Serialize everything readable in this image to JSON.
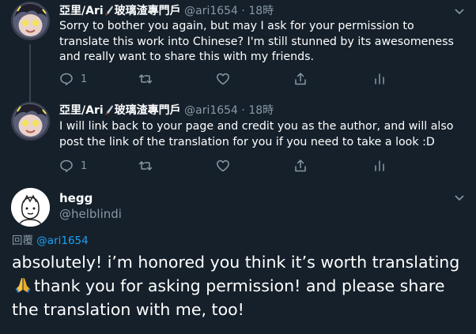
{
  "tweets": [
    {
      "author_name": "亞里/Ari",
      "author_name_suffix": "玻璃渣專門戶",
      "handle": "@ari1654",
      "separator": "·",
      "time": "18時",
      "text": "Sorry to bother you again, but may I ask for your permission to translate this work into Chinese? I'm still stunned by its awesomeness and really want to share this with my friends.",
      "reply_count": "1",
      "retweet_count": "",
      "like_count": ""
    },
    {
      "author_name": "亞里/Ari",
      "author_name_suffix": "玻璃渣專門戶",
      "handle": "@ari1654",
      "separator": "·",
      "time": "18時",
      "text": "I will link back to your page and credit you as the author, and will also post the link of the translation for you if you need to take a look :D",
      "reply_count": "1",
      "retweet_count": "",
      "like_count": ""
    }
  ],
  "reply": {
    "author_name": "hegg",
    "handle": "@helblindi",
    "replying_to_label": "回覆",
    "replying_to_handle": "@ari1654",
    "text_part1": "absolutely! i’m honored you think it’s worth translating",
    "text_part2": "thank you for asking permission! and please share the translation with me, too!"
  },
  "icons": {
    "reply": "comment-icon",
    "retweet": "retweet-icon",
    "like": "heart-icon",
    "share": "share-icon",
    "analytics": "analytics-icon",
    "menu": "chevron-down-icon"
  },
  "colors": {
    "background": "#15202b",
    "text": "#ffffff",
    "muted": "#8899a6",
    "link": "#1da1f2",
    "thread_line": "#38444d"
  }
}
